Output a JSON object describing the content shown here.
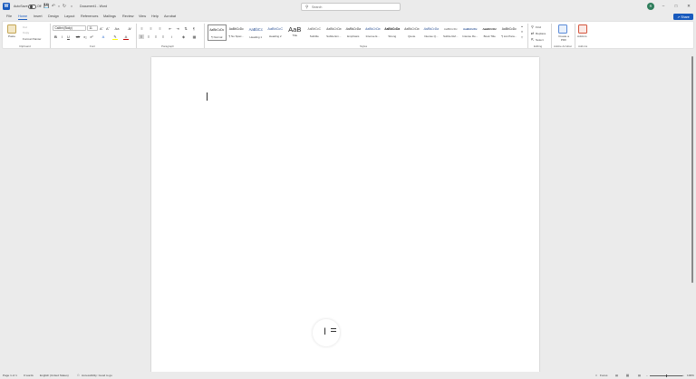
{
  "titlebar": {
    "autosave_label": "AutoSave",
    "autosave_state": "Off",
    "doc_title": "Document1 - Word",
    "search_placeholder": "Search",
    "avatar_initials": "R"
  },
  "tabs": [
    "File",
    "Home",
    "Insert",
    "Design",
    "Layout",
    "References",
    "Mailings",
    "Review",
    "View",
    "Help",
    "Acrobat"
  ],
  "active_tab": "Home",
  "share_label": "Share",
  "ribbon": {
    "clipboard": {
      "paste": "Paste",
      "cut": "Cut",
      "copy": "Copy",
      "format_painter": "Format Painter",
      "label": "Clipboard"
    },
    "font": {
      "family": "Calibri (Body)",
      "size": "11",
      "label": "Font"
    },
    "paragraph": {
      "label": "Paragraph"
    },
    "styles": {
      "label": "Styles",
      "items": [
        {
          "preview": "AaBbCcDc",
          "name": "¶ Normal"
        },
        {
          "preview": "AaBbCcDc",
          "name": "¶ No Spac..."
        },
        {
          "preview": "AaBbCc",
          "name": "Heading 1"
        },
        {
          "preview": "AaBbCcC",
          "name": "Heading 2"
        },
        {
          "preview": "AaB",
          "name": "Title"
        },
        {
          "preview": "AaBbCcC",
          "name": "Subtitle"
        },
        {
          "preview": "AaBbCcDa",
          "name": "Subtle Em..."
        },
        {
          "preview": "AaBbCcDa",
          "name": "Emphasis"
        },
        {
          "preview": "AaBbCcDa",
          "name": "Intense E..."
        },
        {
          "preview": "AaBbCcDa",
          "name": "Strong"
        },
        {
          "preview": "AaBbCcDa",
          "name": "Quote"
        },
        {
          "preview": "AaBbCcDa",
          "name": "Intense Q..."
        },
        {
          "preview": "AaBbCcDc",
          "name": "Subtle Ref..."
        },
        {
          "preview": "AaBbCcDc",
          "name": "Intense Re..."
        },
        {
          "preview": "AaBbCcDc",
          "name": "Book Title"
        },
        {
          "preview": "AaBbCcDc",
          "name": "¶ List Para..."
        }
      ]
    },
    "editing": {
      "find": "Find",
      "replace": "Replace",
      "select": "Select",
      "label": "Editing"
    },
    "acrobat": {
      "create_pdf": "Create a PDF",
      "label": "Adobe Acrobat"
    },
    "addins": {
      "button": "Add-ins",
      "label": "Add-ins"
    }
  },
  "status": {
    "page": "Page 1 of 1",
    "words": "0 words",
    "language": "English (United States)",
    "accessibility": "Accessibility: Good to go",
    "focus": "Focus",
    "zoom": "100%"
  },
  "colors": {
    "accent": "#185abd",
    "highlight": "#ffff00",
    "font_color": "#c00000"
  }
}
